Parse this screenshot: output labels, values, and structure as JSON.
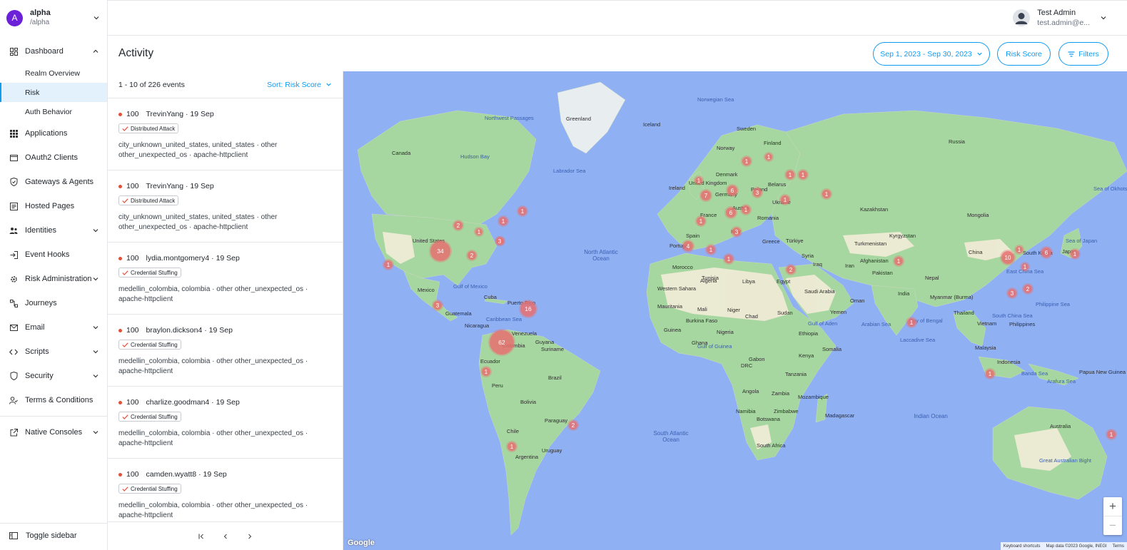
{
  "realm": {
    "avatar": "A",
    "name": "alpha",
    "path": "/alpha"
  },
  "sidebar": {
    "items": [
      {
        "label": "Dashboard",
        "icon": "dashboard-icon",
        "expanded": true
      },
      {
        "label": "Realm Overview"
      },
      {
        "label": "Risk",
        "active": true
      },
      {
        "label": "Auth Behavior"
      },
      {
        "label": "Applications",
        "icon": "apps-grid-icon"
      },
      {
        "label": "OAuth2 Clients",
        "icon": "window-icon"
      },
      {
        "label": "Gateways & Agents",
        "icon": "shield-check-icon"
      },
      {
        "label": "Hosted Pages",
        "icon": "pages-icon"
      },
      {
        "label": "Identities",
        "icon": "people-icon"
      },
      {
        "label": "Event Hooks",
        "icon": "login-arrow-icon"
      },
      {
        "label": "Risk Administration",
        "icon": "gear-icon"
      },
      {
        "label": "Journeys",
        "icon": "journey-icon"
      },
      {
        "label": "Email",
        "icon": "mail-icon"
      },
      {
        "label": "Scripts",
        "icon": "code-icon"
      },
      {
        "label": "Security",
        "icon": "shield-icon"
      },
      {
        "label": "Terms & Conditions",
        "icon": "user-check-icon"
      },
      {
        "label": "Native Consoles",
        "icon": "external-link-icon"
      }
    ],
    "toggle_label": "Toggle sidebar"
  },
  "user": {
    "name": "Test Admin",
    "email": "test.admin@e..."
  },
  "page": {
    "title": "Activity",
    "date_range": "Sep 1, 2023 - Sep 30, 2023",
    "risk_score_label": "Risk Score",
    "filters_label": "Filters"
  },
  "list": {
    "count_label": "1 - 10 of 226 events",
    "sort_label": "Sort: Risk Score",
    "events": [
      {
        "score": "100",
        "title": "TrevinYang · 19 Sep",
        "tag": "Distributed Attack",
        "line1": "city_unknown_united_states, united_states  ·  other",
        "line2": "other_unexpected_os  ·  apache-httpclient"
      },
      {
        "score": "100",
        "title": "TrevinYang · 19 Sep",
        "tag": "Distributed Attack",
        "line1": "city_unknown_united_states, united_states  ·  other",
        "line2": "other_unexpected_os  ·  apache-httpclient"
      },
      {
        "score": "100",
        "title": "lydia.montgomery4 · 19 Sep",
        "tag": "Credential Stuffing",
        "line1": "medellin_colombia, colombia  ·  other other_unexpected_os  ·",
        "line2": "apache-httpclient"
      },
      {
        "score": "100",
        "title": "braylon.dickson4 · 19 Sep",
        "tag": "Credential Stuffing",
        "line1": "medellin_colombia, colombia  ·  other other_unexpected_os  ·",
        "line2": "apache-httpclient"
      },
      {
        "score": "100",
        "title": "charlize.goodman4 · 19 Sep",
        "tag": "Credential Stuffing",
        "line1": "medellin_colombia, colombia  ·  other other_unexpected_os  ·",
        "line2": "apache-httpclient"
      },
      {
        "score": "100",
        "title": "camden.wyatt8 · 19 Sep",
        "tag": "Credential Stuffing",
        "line1": "medellin_colombia, colombia  ·  other other_unexpected_os  ·",
        "line2": "apache-httpclient"
      }
    ]
  },
  "map": {
    "labels": [
      "Greenland",
      "Iceland",
      "Canada",
      "United States",
      "Mexico",
      "Cuba",
      "Puerto Rico",
      "Guatemala",
      "Nicaragua",
      "Venezuela",
      "Guyana",
      "Suriname",
      "Colombia",
      "Ecuador",
      "Peru",
      "Brazil",
      "Bolivia",
      "Paraguay",
      "Chile",
      "Argentina",
      "Uruguay",
      "Norway",
      "Sweden",
      "Finland",
      "Russia",
      "Denmark",
      "Ireland",
      "United Kingdom",
      "Germany",
      "Poland",
      "Belarus",
      "Ukraine",
      "France",
      "Austria",
      "Romania",
      "Spain",
      "Portugal",
      "Italy",
      "Greece",
      "Türkiye",
      "Morocco",
      "Tunisia",
      "Algeria",
      "Libya",
      "Egypt",
      "Western Sahara",
      "Mauritania",
      "Mali",
      "Niger",
      "Chad",
      "Sudan",
      "Burkina Faso",
      "Nigeria",
      "Ghana",
      "Guinea",
      "Ethiopia",
      "Somalia",
      "Kenya",
      "Tanzania",
      "Gabon",
      "DRC",
      "Angola",
      "Zambia",
      "Mozambique",
      "Namibia",
      "Zimbabwe",
      "Botswana",
      "South Africa",
      "Madagascar",
      "Syria",
      "Iraq",
      "Iran",
      "Saudi Arabia",
      "Yemen",
      "Oman",
      "Kazakhstan",
      "Mongolia",
      "Kyrgyzstan",
      "Turkmenistan",
      "Afghanistan",
      "Pakistan",
      "Nepal",
      "India",
      "Myanmar (Burma)",
      "Thailand",
      "Vietnam",
      "China",
      "South Korea",
      "Japan",
      "Philippines",
      "Malaysia",
      "Indonesia",
      "Papua New Guinea",
      "Australia"
    ],
    "sea_labels": [
      "Norwegian Sea",
      "Labrador Sea",
      "Hudson Bay",
      "Northwest Passages",
      "Gulf of Mexico",
      "Caribbean Sea",
      "Gulf of Guinea",
      "Gulf of Aden",
      "Arabian Sea",
      "Bay of Bengal",
      "Laccadive Sea",
      "South China Sea",
      "Philippine Sea",
      "East China Sea",
      "Sea of Japan",
      "Banda Sea",
      "Arafura Sea",
      "Great Australian Bight",
      "Sea of Okhotsk"
    ],
    "ocean_labels": [
      "North Atlantic Ocean",
      "South Atlantic Ocean",
      "Indian Ocean"
    ],
    "markers": [
      "1",
      "34",
      "2",
      "1",
      "1",
      "2",
      "1",
      "1",
      "3",
      "3",
      "16",
      "62",
      "1",
      "2",
      "1",
      "1",
      "7",
      "6",
      "3",
      "1",
      "1",
      "6",
      "1",
      "1",
      "4",
      "1",
      "3",
      "1",
      "2",
      "1",
      "1",
      "1",
      "1",
      "1",
      "10",
      "1",
      "6",
      "1",
      "1",
      "3",
      "2",
      "1",
      "1",
      "1"
    ],
    "attribution": {
      "shortcuts": "Keyboard shortcuts",
      "data": "Map data ©2023 Google, INEGI",
      "terms": "Terms",
      "logo": "Google"
    },
    "zoom_in": "+",
    "zoom_out": "−"
  }
}
